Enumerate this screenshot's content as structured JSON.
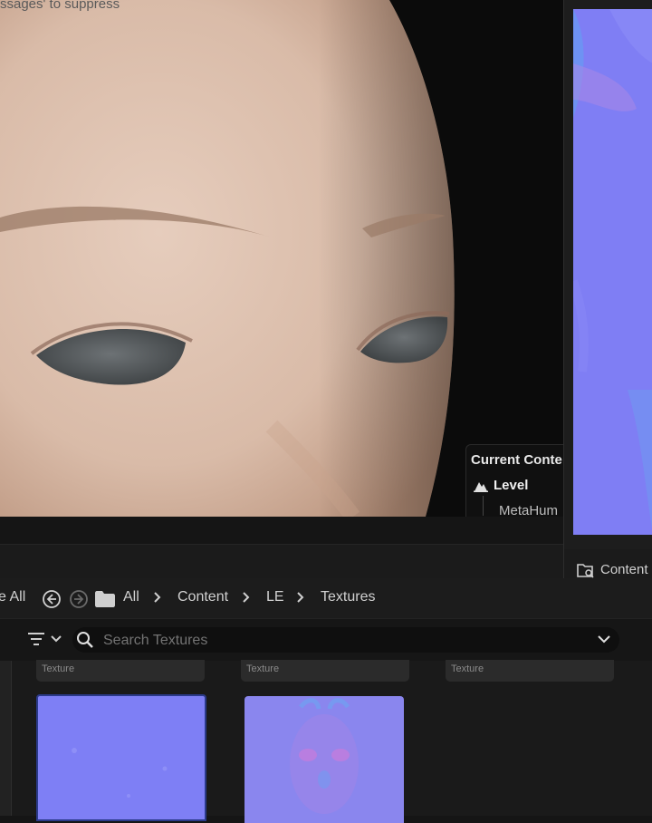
{
  "viewport": {
    "message": "ssages' to suppress",
    "current_content": {
      "title": "Current Conte",
      "level_label": "Level",
      "level_value": "MetaHum"
    }
  },
  "preview_panel": {
    "footer_label": "Content"
  },
  "content_browser": {
    "breadcrumb": {
      "save_all": "e All",
      "items": [
        "All",
        "Content",
        "LE",
        "Textures"
      ]
    },
    "search": {
      "placeholder": "Search Textures"
    },
    "tiles": [
      {
        "type_label": "Texture"
      },
      {
        "type_label": "Texture"
      },
      {
        "type_label": "Texture"
      }
    ]
  },
  "colors": {
    "normal_map_base": "#7f7ef4",
    "panel_bg": "#1a1a1a",
    "search_bg": "#0f0f0f"
  }
}
